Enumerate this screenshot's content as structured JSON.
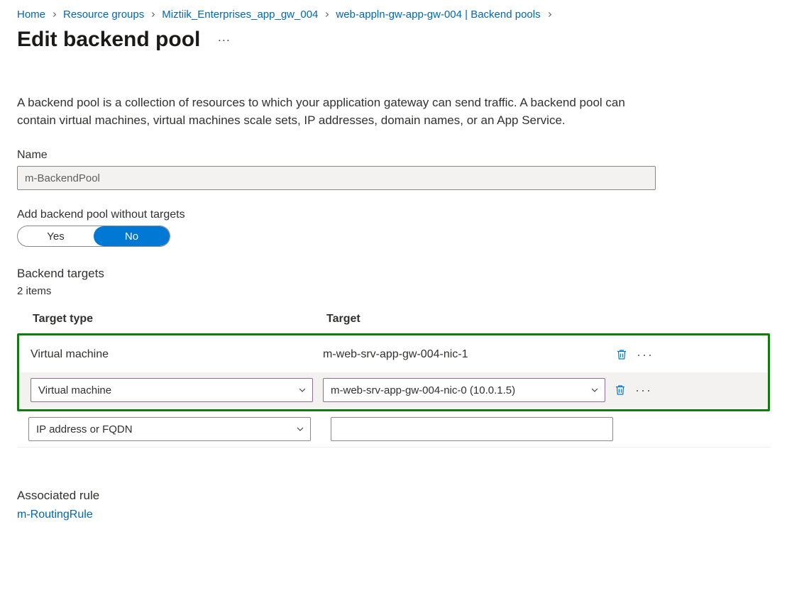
{
  "breadcrumb": {
    "items": [
      {
        "label": "Home"
      },
      {
        "label": "Resource groups"
      },
      {
        "label": "Miztiik_Enterprises_app_gw_004"
      },
      {
        "label": "web-appln-gw-app-gw-004 | Backend pools"
      }
    ]
  },
  "page": {
    "title": "Edit backend pool",
    "description": "A backend pool is a collection of resources to which your application gateway can send traffic. A backend pool can contain virtual machines, virtual machines scale sets, IP addresses, domain names, or an App Service."
  },
  "form": {
    "name_label": "Name",
    "name_value": "m-BackendPool",
    "without_targets_label": "Add backend pool without targets",
    "opt_yes": "Yes",
    "opt_no": "No"
  },
  "targets": {
    "section_label": "Backend targets",
    "count_text": "2 items",
    "col_type": "Target type",
    "col_target": "Target",
    "rows": [
      {
        "type": "Virtual machine",
        "target": "m-web-srv-app-gw-004-nic-1"
      },
      {
        "type": "Virtual machine",
        "target": "m-web-srv-app-gw-004-nic-0 (10.0.1.5)"
      }
    ],
    "new_type": "IP address or FQDN"
  },
  "assoc": {
    "label": "Associated rule",
    "link": "m-RoutingRule"
  },
  "icons": {
    "more": "···"
  }
}
